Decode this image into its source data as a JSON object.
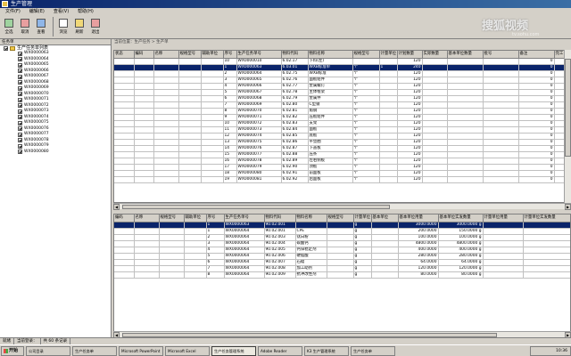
{
  "window": {
    "title": "生产管理"
  },
  "menu": [
    "文件(F)",
    "编辑(E)",
    "查看(V)",
    "帮助(H)"
  ],
  "toolbar": [
    {
      "label": "全选",
      "icon": "select-all-icon"
    },
    {
      "label": "取消",
      "icon": "cancel-icon"
    },
    {
      "label": "查看",
      "icon": "view-icon"
    },
    {
      "label": "浏览",
      "icon": "browse-icon"
    },
    {
      "label": "刷新",
      "icon": "refresh-icon"
    },
    {
      "label": "退出",
      "icon": "exit-icon"
    }
  ],
  "breadcrumb": "当前位置：生产任务 > 生产单",
  "left": {
    "header": "任务单",
    "root": "生产任务单列表",
    "items": [
      "WX0000063",
      "WX0000064",
      "WX0000065",
      "WX0000066",
      "WX0000067",
      "WX0000068",
      "WX0000069",
      "WX0000070",
      "WX0000071",
      "WX0000072",
      "WX0000073",
      "WX0000074",
      "WX0000075",
      "WX0000076",
      "WX0000077",
      "WX0000078",
      "WX0000079",
      "WX0000080"
    ]
  },
  "top_grid": {
    "headers": [
      "状态",
      "编码",
      "名称",
      "规格型号",
      "辅助单位",
      "序号",
      "生产任务单号",
      "物料代码",
      "物料名称",
      "规格型号",
      "计量单位",
      "计划数量",
      "实际数量",
      "基本单位数量",
      "批号",
      "备注",
      "完工"
    ],
    "rows": [
      [
        "",
        "",
        "",
        "",
        "",
        "10",
        "WX0000010",
        "6.02.17",
        "下料(左)",
        "",
        " ",
        "120",
        "",
        "",
        "",
        "0",
        ""
      ],
      [
        "",
        "",
        "",
        "",
        "",
        "1",
        "WX0000063",
        "6.03.01",
        "WXB标准单",
        "个",
        "1",
        "240",
        "",
        "",
        "",
        "0",
        ""
      ],
      [
        "",
        "",
        "",
        "",
        "",
        "2",
        "WX0000064",
        "6.02.75",
        "WXB标准",
        "个",
        "",
        "120",
        "",
        "",
        "",
        "0",
        ""
      ],
      [
        "",
        "",
        "",
        "",
        "",
        "3",
        "WX0000065",
        "6.02.76",
        "面板组件",
        "个",
        "",
        "120",
        "",
        "",
        "",
        "0",
        ""
      ],
      [
        "",
        "",
        "",
        "",
        "",
        "4",
        "WX0000066",
        "6.02.77",
        "金属螺钉",
        "个",
        "",
        "120",
        "",
        "",
        "",
        "0",
        ""
      ],
      [
        "",
        "",
        "",
        "",
        "",
        "5",
        "WX0000067",
        "6.02.78",
        "主体框架",
        "个",
        "",
        "120",
        "",
        "",
        "",
        "0",
        ""
      ],
      [
        "",
        "",
        "",
        "",
        "",
        "6",
        "WX0000068",
        "6.02.79",
        "金属件",
        "个",
        "",
        "120",
        "",
        "",
        "",
        "0",
        ""
      ],
      [
        "",
        "",
        "",
        "",
        "",
        "7",
        "WX0000069",
        "6.02.80",
        "C型钢",
        "个",
        "",
        "120",
        "",
        "",
        "",
        "0",
        ""
      ],
      [
        "",
        "",
        "",
        "",
        "",
        "8",
        "WX0000070",
        "6.02.81",
        "角钢",
        "个",
        "",
        "120",
        "",
        "",
        "",
        "0",
        ""
      ],
      [
        "",
        "",
        "",
        "",
        "",
        "9",
        "WX0000071",
        "6.02.82",
        "压板组件",
        "个",
        "",
        "120",
        "",
        "",
        "",
        "0",
        ""
      ],
      [
        "",
        "",
        "",
        "",
        "",
        "10",
        "WX0000072",
        "6.02.83",
        "支架",
        "个",
        "",
        "120",
        "",
        "",
        "",
        "0",
        ""
      ],
      [
        "",
        "",
        "",
        "",
        "",
        "11",
        "WX0000073",
        "6.02.84",
        "面板",
        "个",
        "",
        "120",
        "",
        "",
        "",
        "0",
        ""
      ],
      [
        "",
        "",
        "",
        "",
        "",
        "12",
        "WX0000074",
        "6.02.85",
        "底板",
        "个",
        "",
        "120",
        "",
        "",
        "",
        "0",
        ""
      ],
      [
        "",
        "",
        "",
        "",
        "",
        "13",
        "WX0000075",
        "6.02.86",
        "平垫圈",
        "个",
        "",
        "120",
        "",
        "",
        "",
        "0",
        ""
      ],
      [
        "",
        "",
        "",
        "",
        "",
        "14",
        "WX0000076",
        "6.02.87",
        "下盖板",
        "个",
        "",
        "120",
        "",
        "",
        "",
        "0",
        ""
      ],
      [
        "",
        "",
        "",
        "",
        "",
        "15",
        "WX0000077",
        "6.02.88",
        "压条",
        "个",
        "",
        "120",
        "",
        "",
        "",
        "0",
        ""
      ],
      [
        "",
        "",
        "",
        "",
        "",
        "16",
        "WX0000078",
        "6.02.89",
        "左右侧板",
        "个",
        "",
        "120",
        "",
        "",
        "",
        "0",
        ""
      ],
      [
        "",
        "",
        "",
        "",
        "",
        "17",
        "WX0000079",
        "6.02.90",
        "顶板",
        "个",
        "",
        "120",
        "",
        "",
        "",
        "0",
        ""
      ],
      [
        "",
        "",
        "",
        "",
        "",
        "18",
        "WX0000080",
        "6.02.91",
        "前面板",
        "个",
        "",
        "120",
        "",
        "",
        "",
        "0",
        ""
      ],
      [
        "",
        "",
        "",
        "",
        "",
        "19",
        "WX0000081",
        "6.02.92",
        "后面板",
        "个",
        "",
        "120",
        "",
        "",
        "",
        "0",
        ""
      ]
    ]
  },
  "bottom_grid": {
    "headers": [
      "编码",
      "名称",
      "规格型号",
      "辅助单位",
      "序号",
      "生产任务单号",
      "物料代码",
      "物料名称",
      "规格型号",
      "计量单位",
      "基本单位",
      "基本单位用量",
      "基本单位实发数量",
      "计量单位用量",
      "计量单位实发数量"
    ],
    "rows": [
      [
        "",
        "",
        "",
        "",
        "1",
        "WX0000063",
        "90.02.001",
        "",
        "",
        "g",
        "",
        "3000.0000",
        "3000.0000 g",
        "",
        ""
      ],
      [
        "",
        "",
        "",
        "",
        "1",
        "WX0000064",
        "90.02.001",
        "CPE",
        "",
        "g",
        "",
        "200.0000",
        "150.0000 g",
        "",
        ""
      ],
      [
        "",
        "",
        "",
        "",
        "2",
        "WX0000064",
        "90.02.003",
        "钛白粉",
        "",
        "g",
        "",
        "100.0000",
        "100.0000 g",
        "",
        ""
      ],
      [
        "",
        "",
        "",
        "",
        "3",
        "WX0000064",
        "90.02.004",
        "碳酸钙",
        "",
        "g",
        "",
        "4800.0000",
        "4800.0000 g",
        "",
        ""
      ],
      [
        "",
        "",
        "",
        "",
        "4",
        "WX0000064",
        "90.02.005",
        "钙锌稳定剂",
        "",
        "g",
        "",
        "400.0000",
        "400.0000 g",
        "",
        ""
      ],
      [
        "",
        "",
        "",
        "",
        "5",
        "WX0000064",
        "90.02.006",
        "硬脂酸",
        "",
        "g",
        "",
        "280.0000",
        "280.0000 g",
        "",
        ""
      ],
      [
        "",
        "",
        "",
        "",
        "6",
        "WX0000064",
        "90.02.007",
        "石蜡",
        "",
        "g",
        "",
        "64.0000",
        "64.0000 g",
        "",
        ""
      ],
      [
        "",
        "",
        "",
        "",
        "7",
        "WX0000064",
        "90.02.008",
        "加工助剂",
        "",
        "g",
        "",
        "120.0000",
        "120.0000 g",
        "",
        ""
      ],
      [
        "",
        "",
        "",
        "",
        "8",
        "WX0000064",
        "90.02.009",
        "抗冲改性剂",
        "",
        "g",
        "",
        "80.0000",
        "80.0000 g",
        "",
        ""
      ]
    ]
  },
  "status": [
    "就绪",
    "当前登录：",
    "共 60 条记录"
  ],
  "taskbar": {
    "start": "开始",
    "tasks": [
      "公司目录",
      "生产任务单",
      "Microsoft PowerPoint",
      "Microsoft Excel",
      "生产任务管理系统",
      "Adobe Reader",
      "K3 生产管理系统",
      "生产任务单"
    ],
    "clock": "10:36"
  },
  "watermark": {
    "main": "搜狐视频",
    "sub": "tv.sohu.com"
  }
}
